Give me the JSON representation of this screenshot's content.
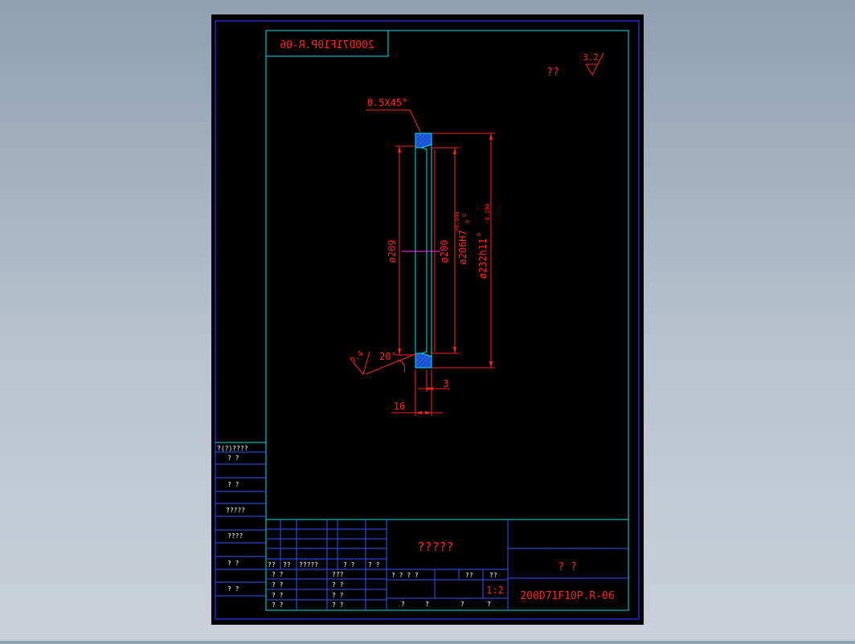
{
  "colors": {
    "background": "#000000",
    "frame_outer": "#3333ff",
    "frame_inner": "#00e5e5",
    "dimension": "#ff2222",
    "part_fill": "#1a4fd0",
    "centerline": "#ff33ff",
    "table_lines": "#3355ff",
    "table_text": "#ffffff",
    "title_text": "#ff2222"
  },
  "drawing": {
    "mirrored_code": "200D71F10P.R-06",
    "roughness_label": "??",
    "roughness_value": "3.2",
    "chamfer_label": "0.5X45°",
    "dim_209": "ø209",
    "dim_200": "ø200",
    "dim_206": "ø206H7",
    "dim_206_tol_upper": "+0.046",
    "dim_206_tol_mid": "0",
    "dim_206_tol_lower": "0",
    "dim_232": "ø232h11",
    "dim_232_tol_upper": "0",
    "dim_232_tol_lower": "-0.290",
    "angle_label": "20°",
    "surface_small": "0.4",
    "dim_3": "3",
    "dim_16": "16"
  },
  "left_column": {
    "rows": [
      "?(?)????",
      "?   ?",
      "?   ?",
      "?????",
      "????",
      "?   ?",
      "?   ?"
    ]
  },
  "title_block": {
    "left_header_row": [
      "??",
      "??",
      "?????",
      "?   ?",
      "?   ?"
    ],
    "left_rows": [
      [
        "?  ?",
        "???"
      ],
      [
        "?  ?",
        "?  ?"
      ],
      [
        "?  ?",
        "?  ?"
      ],
      [
        "?  ?",
        "?  ?"
      ]
    ],
    "middle_title": "?????",
    "middle_row_1": [
      "?  ?  ?  ?",
      "??",
      "??"
    ],
    "scale": "1:2",
    "middle_row_3": [
      "?",
      "?",
      "?",
      "?"
    ],
    "right_name": "?    ?",
    "drawing_number": "200D71F10P.R-06"
  }
}
